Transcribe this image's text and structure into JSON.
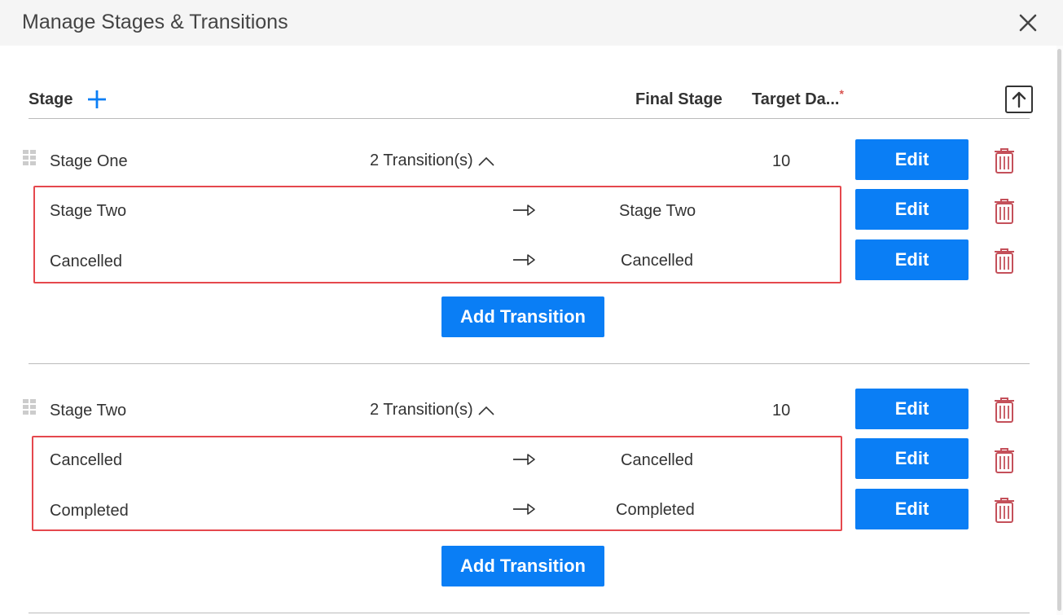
{
  "dialog": {
    "title": "Manage Stages & Transitions",
    "close_icon": "close-icon"
  },
  "columns": {
    "stage": "Stage",
    "final_stage": "Final Stage",
    "target_days": "Target Da...",
    "required_mark": "*"
  },
  "icons": {
    "add_stage": "plus-icon",
    "collapse_all": "arrow-up-icon",
    "drag": "drag-handle-icon",
    "transition_arrow": "arrow-right-icon",
    "delete": "trash-icon"
  },
  "colors": {
    "primary_button": "#0a7ef5",
    "highlight_border": "#e5484d",
    "trash_icon": "#c4505a",
    "plus_icon": "#0a7ef5"
  },
  "stages": [
    {
      "name": "Stage One",
      "transitions_label": "2 Transition(s)",
      "target_days": "10",
      "edit_label": "Edit",
      "transitions": [
        {
          "from": "Stage Two",
          "to": "Stage Two",
          "edit_label": "Edit"
        },
        {
          "from": "Cancelled",
          "to": "Cancelled",
          "edit_label": "Edit"
        }
      ],
      "add_transition_label": "Add Transition"
    },
    {
      "name": "Stage Two",
      "transitions_label": "2 Transition(s)",
      "target_days": "10",
      "edit_label": "Edit",
      "transitions": [
        {
          "from": "Cancelled",
          "to": "Cancelled",
          "edit_label": "Edit"
        },
        {
          "from": "Completed",
          "to": "Completed",
          "edit_label": "Edit"
        }
      ],
      "add_transition_label": "Add Transition"
    }
  ]
}
